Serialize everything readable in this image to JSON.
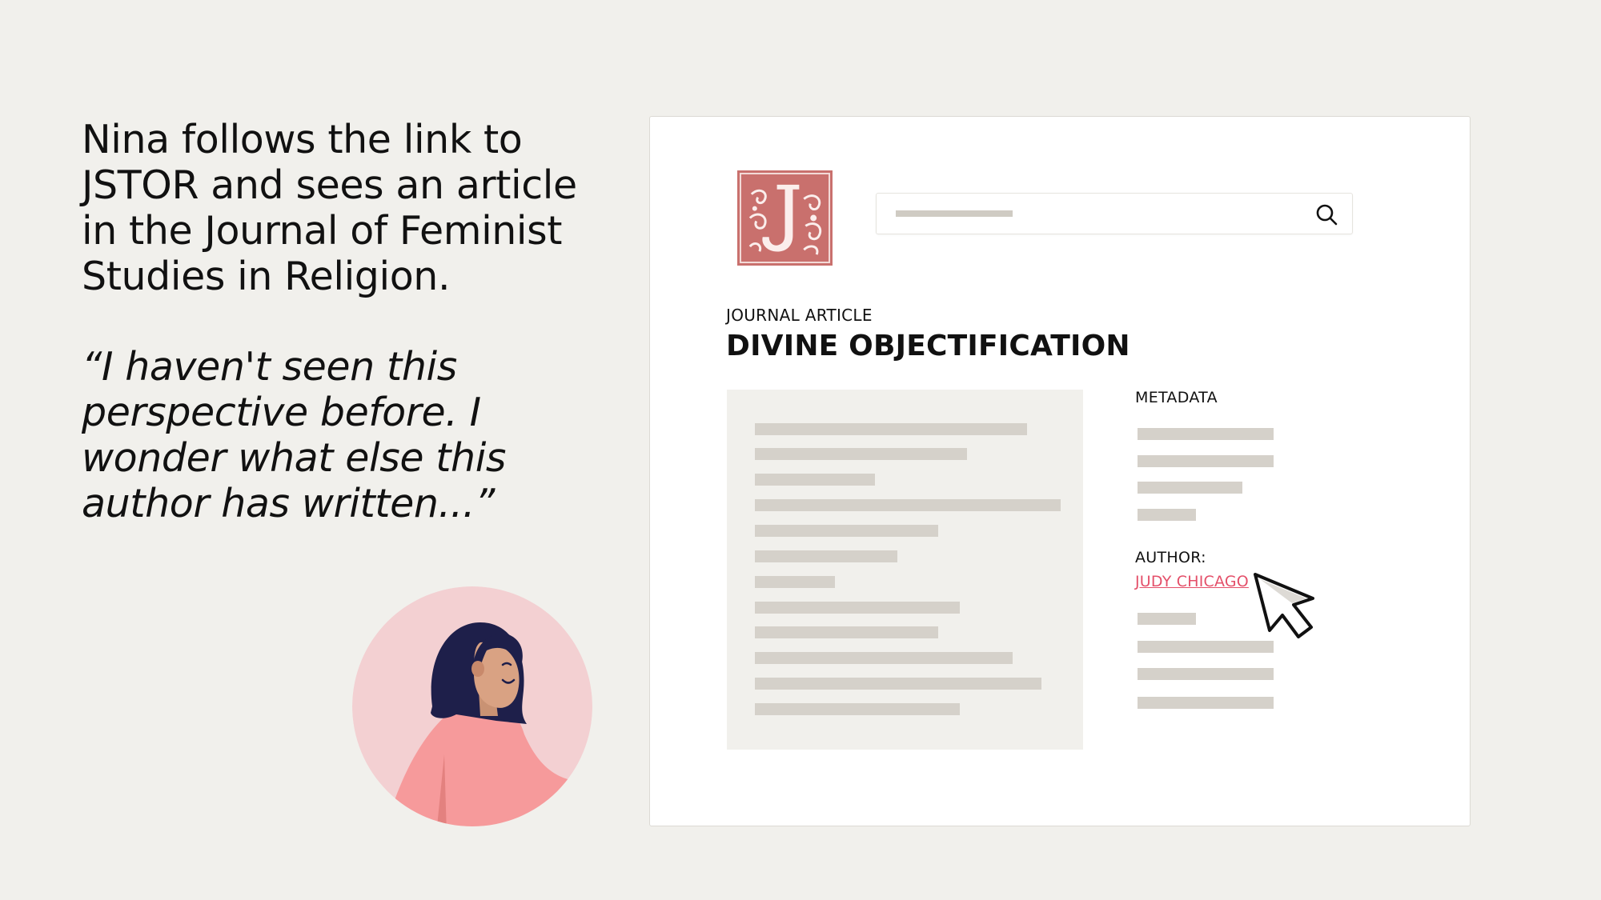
{
  "narrative": {
    "text": "Nina follows the link to JSTOR and sees an article in the Journal of Feminist Studies in Religion.",
    "quote": "“I haven't seen this perspective before. I wonder what else this author has written...”"
  },
  "avatar": {
    "icon": "woman-avatar-icon"
  },
  "browser": {
    "logo": {
      "icon": "jstor-logo-icon"
    },
    "search": {
      "icon": "search-icon"
    },
    "article": {
      "type": "JOURNAL ARTICLE",
      "title": "DIVINE OBJECTIFICATION"
    },
    "sidebar": {
      "metadata_label": "METADATA",
      "author_label": "AUTHOR:",
      "author_name": "JUDY CHICAGO"
    },
    "cursor": {
      "icon": "pointer-cursor-icon"
    }
  },
  "colors": {
    "background": "#f1f0ec",
    "panel": "#ffffff",
    "accent_link": "#e4506a",
    "logo": "#c9706d",
    "placeholder": "#d5d1ca"
  }
}
